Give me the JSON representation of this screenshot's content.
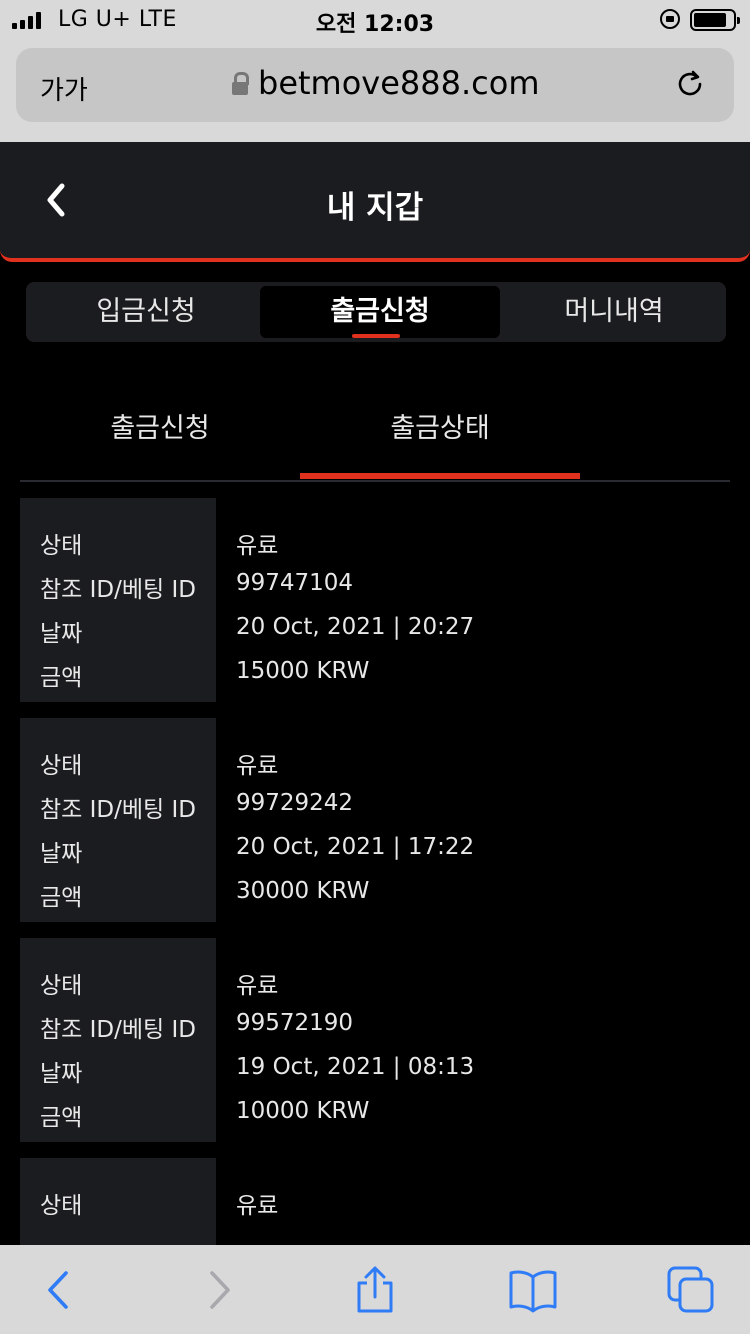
{
  "status_bar": {
    "carrier": "LG U+  LTE",
    "time": "오전 12:03"
  },
  "browser": {
    "text_size_label": "가가",
    "url": "betmove888.com"
  },
  "header": {
    "title": "내 지갑"
  },
  "segments": [
    {
      "label": "입금신청",
      "active": false
    },
    {
      "label": "출금신청",
      "active": true
    },
    {
      "label": "머니내역",
      "active": false
    }
  ],
  "subtabs": [
    {
      "label": "출금신청",
      "active": false
    },
    {
      "label": "출금상태",
      "active": true
    }
  ],
  "records": [
    {
      "labels": [
        "상태",
        "참조 ID/베팅 ID",
        "날짜",
        "금액"
      ],
      "values": [
        "유료",
        "99747104",
        "20 Oct, 2021 | 20:27",
        "15000 KRW"
      ]
    },
    {
      "labels": [
        "상태",
        "참조 ID/베팅 ID",
        "날짜",
        "금액"
      ],
      "values": [
        "유료",
        "99729242",
        "20 Oct, 2021 | 17:22",
        "30000 KRW"
      ]
    },
    {
      "labels": [
        "상태",
        "참조 ID/베팅 ID",
        "날짜",
        "금액"
      ],
      "values": [
        "유료",
        "99572190",
        "19 Oct, 2021 | 08:13",
        "10000 KRW"
      ]
    },
    {
      "labels": [
        "상태"
      ],
      "values": [
        "유료"
      ]
    }
  ],
  "colors": {
    "accent": "#e0301e",
    "panel": "#1b1c1f",
    "background": "#000000",
    "ios_blue": "#2f7cf6"
  },
  "icons": [
    "back-chevron-icon",
    "lock-icon",
    "reload-icon",
    "share-icon",
    "bookmarks-icon",
    "tabs-icon"
  ]
}
